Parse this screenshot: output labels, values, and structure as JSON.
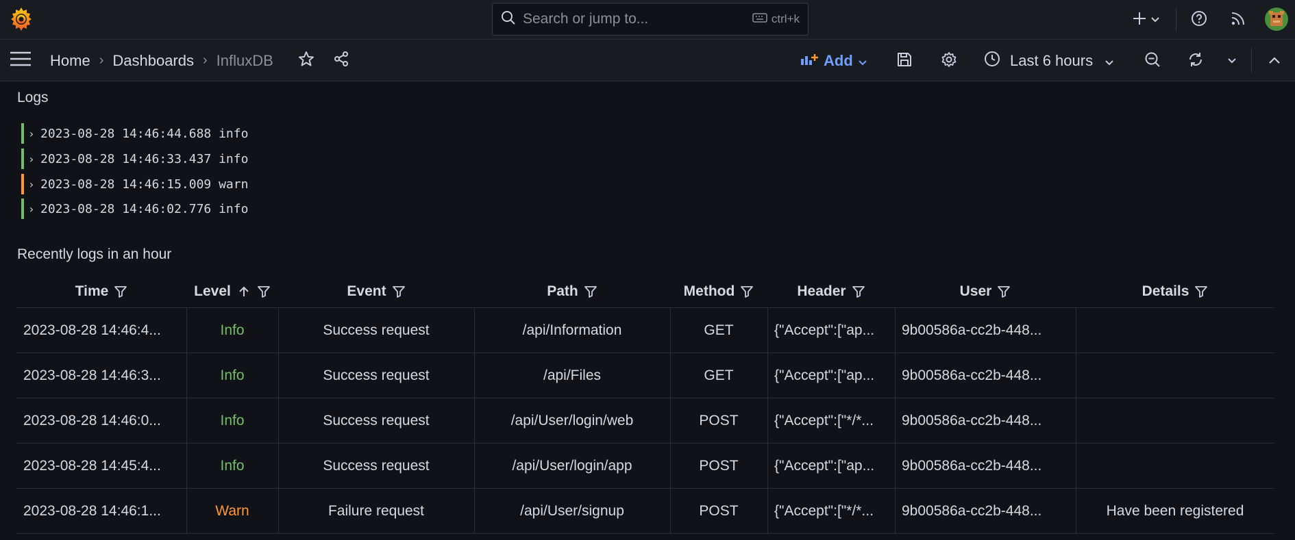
{
  "topbar": {
    "search_placeholder": "Search or jump to...",
    "search_shortcut": "ctrl+k",
    "icons": [
      "grafana-logo-icon",
      "search-icon",
      "keyboard-icon",
      "plus-icon",
      "chevron-down-icon",
      "help-icon",
      "rss-icon",
      "avatar"
    ]
  },
  "navbar": {
    "breadcrumbs": [
      "Home",
      "Dashboards",
      "InfluxDB"
    ],
    "add_label": "Add",
    "time_range": "Last 6 hours",
    "accent": "#6e9fff"
  },
  "logs_panel": {
    "title": "Logs",
    "rows": [
      {
        "text": "2023-08-28 14:46:44.688 info",
        "level": "info",
        "color": "#73bf69"
      },
      {
        "text": "2023-08-28 14:46:33.437 info",
        "level": "info",
        "color": "#73bf69"
      },
      {
        "text": "2023-08-28 14:46:15.009 warn",
        "level": "warn",
        "color": "#ff9830"
      },
      {
        "text": "2023-08-28 14:46:02.776 info",
        "level": "info",
        "color": "#73bf69"
      }
    ]
  },
  "table_panel": {
    "title": "Recently logs in an hour",
    "columns": [
      "Time",
      "Level",
      "Event",
      "Path",
      "Method",
      "Header",
      "User",
      "Details"
    ],
    "rows": [
      [
        "2023-08-28 14:46:4...",
        "Info",
        "Success request",
        "/api/Information",
        "GET",
        "{\"Accept\":[\"ap...",
        "9b00586a-cc2b-448...",
        ""
      ],
      [
        "2023-08-28 14:46:3...",
        "Info",
        "Success request",
        "/api/Files",
        "GET",
        "{\"Accept\":[\"ap...",
        "9b00586a-cc2b-448...",
        ""
      ],
      [
        "2023-08-28 14:46:0...",
        "Info",
        "Success request",
        "/api/User/login/web",
        "POST",
        "{\"Accept\":[\"*/*...",
        "9b00586a-cc2b-448...",
        ""
      ],
      [
        "2023-08-28 14:45:4...",
        "Info",
        "Success request",
        "/api/User/login/app",
        "POST",
        "{\"Accept\":[\"ap...",
        "9b00586a-cc2b-448...",
        ""
      ],
      [
        "2023-08-28 14:46:1...",
        "Warn",
        "Failure request",
        "/api/User/signup",
        "POST",
        "{\"Accept\":[\"*/*...",
        "9b00586a-cc2b-448...",
        "Have been registered"
      ]
    ],
    "level_colors": {
      "Info": "#73bf69",
      "Warn": "#ff9830"
    }
  }
}
